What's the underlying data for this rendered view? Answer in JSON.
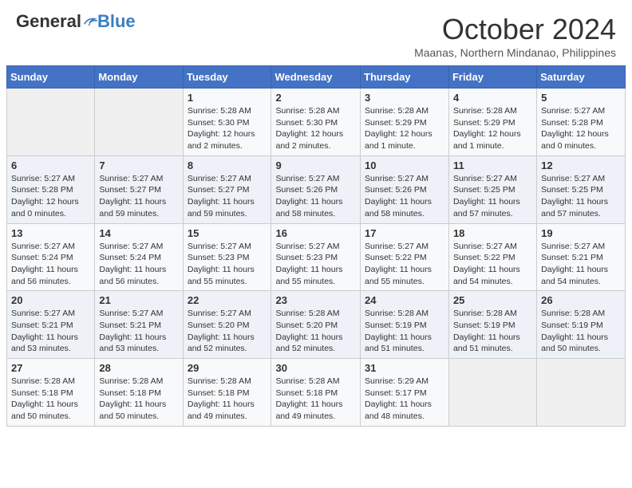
{
  "header": {
    "logo_general": "General",
    "logo_blue": "Blue",
    "month": "October 2024",
    "location": "Maanas, Northern Mindanao, Philippines"
  },
  "days_of_week": [
    "Sunday",
    "Monday",
    "Tuesday",
    "Wednesday",
    "Thursday",
    "Friday",
    "Saturday"
  ],
  "weeks": [
    [
      {
        "day": "",
        "sunrise": "",
        "sunset": "",
        "daylight": ""
      },
      {
        "day": "",
        "sunrise": "",
        "sunset": "",
        "daylight": ""
      },
      {
        "day": "1",
        "sunrise": "Sunrise: 5:28 AM",
        "sunset": "Sunset: 5:30 PM",
        "daylight": "Daylight: 12 hours and 2 minutes."
      },
      {
        "day": "2",
        "sunrise": "Sunrise: 5:28 AM",
        "sunset": "Sunset: 5:30 PM",
        "daylight": "Daylight: 12 hours and 2 minutes."
      },
      {
        "day": "3",
        "sunrise": "Sunrise: 5:28 AM",
        "sunset": "Sunset: 5:29 PM",
        "daylight": "Daylight: 12 hours and 1 minute."
      },
      {
        "day": "4",
        "sunrise": "Sunrise: 5:28 AM",
        "sunset": "Sunset: 5:29 PM",
        "daylight": "Daylight: 12 hours and 1 minute."
      },
      {
        "day": "5",
        "sunrise": "Sunrise: 5:27 AM",
        "sunset": "Sunset: 5:28 PM",
        "daylight": "Daylight: 12 hours and 0 minutes."
      }
    ],
    [
      {
        "day": "6",
        "sunrise": "Sunrise: 5:27 AM",
        "sunset": "Sunset: 5:28 PM",
        "daylight": "Daylight: 12 hours and 0 minutes."
      },
      {
        "day": "7",
        "sunrise": "Sunrise: 5:27 AM",
        "sunset": "Sunset: 5:27 PM",
        "daylight": "Daylight: 11 hours and 59 minutes."
      },
      {
        "day": "8",
        "sunrise": "Sunrise: 5:27 AM",
        "sunset": "Sunset: 5:27 PM",
        "daylight": "Daylight: 11 hours and 59 minutes."
      },
      {
        "day": "9",
        "sunrise": "Sunrise: 5:27 AM",
        "sunset": "Sunset: 5:26 PM",
        "daylight": "Daylight: 11 hours and 58 minutes."
      },
      {
        "day": "10",
        "sunrise": "Sunrise: 5:27 AM",
        "sunset": "Sunset: 5:26 PM",
        "daylight": "Daylight: 11 hours and 58 minutes."
      },
      {
        "day": "11",
        "sunrise": "Sunrise: 5:27 AM",
        "sunset": "Sunset: 5:25 PM",
        "daylight": "Daylight: 11 hours and 57 minutes."
      },
      {
        "day": "12",
        "sunrise": "Sunrise: 5:27 AM",
        "sunset": "Sunset: 5:25 PM",
        "daylight": "Daylight: 11 hours and 57 minutes."
      }
    ],
    [
      {
        "day": "13",
        "sunrise": "Sunrise: 5:27 AM",
        "sunset": "Sunset: 5:24 PM",
        "daylight": "Daylight: 11 hours and 56 minutes."
      },
      {
        "day": "14",
        "sunrise": "Sunrise: 5:27 AM",
        "sunset": "Sunset: 5:24 PM",
        "daylight": "Daylight: 11 hours and 56 minutes."
      },
      {
        "day": "15",
        "sunrise": "Sunrise: 5:27 AM",
        "sunset": "Sunset: 5:23 PM",
        "daylight": "Daylight: 11 hours and 55 minutes."
      },
      {
        "day": "16",
        "sunrise": "Sunrise: 5:27 AM",
        "sunset": "Sunset: 5:23 PM",
        "daylight": "Daylight: 11 hours and 55 minutes."
      },
      {
        "day": "17",
        "sunrise": "Sunrise: 5:27 AM",
        "sunset": "Sunset: 5:22 PM",
        "daylight": "Daylight: 11 hours and 55 minutes."
      },
      {
        "day": "18",
        "sunrise": "Sunrise: 5:27 AM",
        "sunset": "Sunset: 5:22 PM",
        "daylight": "Daylight: 11 hours and 54 minutes."
      },
      {
        "day": "19",
        "sunrise": "Sunrise: 5:27 AM",
        "sunset": "Sunset: 5:21 PM",
        "daylight": "Daylight: 11 hours and 54 minutes."
      }
    ],
    [
      {
        "day": "20",
        "sunrise": "Sunrise: 5:27 AM",
        "sunset": "Sunset: 5:21 PM",
        "daylight": "Daylight: 11 hours and 53 minutes."
      },
      {
        "day": "21",
        "sunrise": "Sunrise: 5:27 AM",
        "sunset": "Sunset: 5:21 PM",
        "daylight": "Daylight: 11 hours and 53 minutes."
      },
      {
        "day": "22",
        "sunrise": "Sunrise: 5:27 AM",
        "sunset": "Sunset: 5:20 PM",
        "daylight": "Daylight: 11 hours and 52 minutes."
      },
      {
        "day": "23",
        "sunrise": "Sunrise: 5:28 AM",
        "sunset": "Sunset: 5:20 PM",
        "daylight": "Daylight: 11 hours and 52 minutes."
      },
      {
        "day": "24",
        "sunrise": "Sunrise: 5:28 AM",
        "sunset": "Sunset: 5:19 PM",
        "daylight": "Daylight: 11 hours and 51 minutes."
      },
      {
        "day": "25",
        "sunrise": "Sunrise: 5:28 AM",
        "sunset": "Sunset: 5:19 PM",
        "daylight": "Daylight: 11 hours and 51 minutes."
      },
      {
        "day": "26",
        "sunrise": "Sunrise: 5:28 AM",
        "sunset": "Sunset: 5:19 PM",
        "daylight": "Daylight: 11 hours and 50 minutes."
      }
    ],
    [
      {
        "day": "27",
        "sunrise": "Sunrise: 5:28 AM",
        "sunset": "Sunset: 5:18 PM",
        "daylight": "Daylight: 11 hours and 50 minutes."
      },
      {
        "day": "28",
        "sunrise": "Sunrise: 5:28 AM",
        "sunset": "Sunset: 5:18 PM",
        "daylight": "Daylight: 11 hours and 50 minutes."
      },
      {
        "day": "29",
        "sunrise": "Sunrise: 5:28 AM",
        "sunset": "Sunset: 5:18 PM",
        "daylight": "Daylight: 11 hours and 49 minutes."
      },
      {
        "day": "30",
        "sunrise": "Sunrise: 5:28 AM",
        "sunset": "Sunset: 5:18 PM",
        "daylight": "Daylight: 11 hours and 49 minutes."
      },
      {
        "day": "31",
        "sunrise": "Sunrise: 5:29 AM",
        "sunset": "Sunset: 5:17 PM",
        "daylight": "Daylight: 11 hours and 48 minutes."
      },
      {
        "day": "",
        "sunrise": "",
        "sunset": "",
        "daylight": ""
      },
      {
        "day": "",
        "sunrise": "",
        "sunset": "",
        "daylight": ""
      }
    ]
  ]
}
